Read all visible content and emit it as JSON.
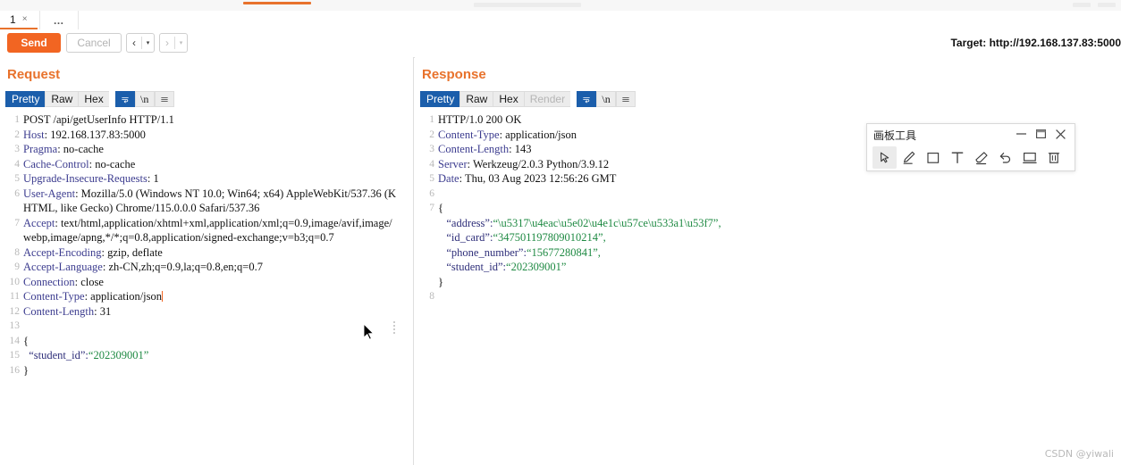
{
  "window": {
    "tabs": [
      {
        "label": "1",
        "close": "×"
      },
      {
        "label": "…"
      }
    ],
    "target_label": "Target: http://192.168.137.83:5000"
  },
  "actionbar": {
    "send_label": "Send",
    "cancel_label": "Cancel",
    "back_chevron": "‹",
    "forward_chevron": "›",
    "caret": "▾"
  },
  "request": {
    "title": "Request",
    "tabs": [
      {
        "label": "Pretty",
        "state": "on"
      },
      {
        "label": "Raw",
        "state": "off"
      },
      {
        "label": "Hex",
        "state": "off"
      }
    ],
    "icon_buttons": [
      {
        "name": "word-wrap-icon",
        "state": "on"
      },
      {
        "name": "newline-icon",
        "label": "\\n",
        "state": "off"
      },
      {
        "name": "hamburger-menu-icon",
        "state": "off"
      }
    ],
    "lines": [
      {
        "n": "1",
        "segments": [
          {
            "t": "POST /api/getUserInfo HTTP/1.1",
            "c": "plain"
          }
        ]
      },
      {
        "n": "2",
        "segments": [
          {
            "t": "Host",
            "c": "hdrname"
          },
          {
            "t": ": 192.168.137.83:5000",
            "c": "plain"
          }
        ]
      },
      {
        "n": "3",
        "segments": [
          {
            "t": "Pragma",
            "c": "hdrname"
          },
          {
            "t": ": no-cache",
            "c": "plain"
          }
        ]
      },
      {
        "n": "4",
        "segments": [
          {
            "t": "Cache-Control",
            "c": "hdrname"
          },
          {
            "t": ": no-cache",
            "c": "plain"
          }
        ]
      },
      {
        "n": "5",
        "segments": [
          {
            "t": "Upgrade-Insecure-Requests",
            "c": "hdrname"
          },
          {
            "t": ": 1",
            "c": "plain"
          }
        ]
      },
      {
        "n": "6",
        "segments": [
          {
            "t": "User-Agent",
            "c": "hdrname"
          },
          {
            "t": ": Mozilla/5.0 (Windows NT 10.0; Win64; x64) AppleWebKit/537.36 (KHTML, like Gecko) Chrome/115.0.0.0 Safari/537.36",
            "c": "plain"
          }
        ]
      },
      {
        "n": "7",
        "segments": [
          {
            "t": "Accept",
            "c": "hdrname"
          },
          {
            "t": ": text/html,application/xhtml+xml,application/xml;q=0.9,image/avif,image/webp,image/apng,*/*;q=0.8,application/signed-exchange;v=b3;q=0.7",
            "c": "plain"
          }
        ]
      },
      {
        "n": "8",
        "segments": [
          {
            "t": "Accept-Encoding",
            "c": "hdrname"
          },
          {
            "t": ": gzip, deflate",
            "c": "plain"
          }
        ]
      },
      {
        "n": "9",
        "segments": [
          {
            "t": "Accept-Language",
            "c": "hdrname"
          },
          {
            "t": ": zh-CN,zh;q=0.9,la;q=0.8,en;q=0.7",
            "c": "plain"
          }
        ]
      },
      {
        "n": "10",
        "segments": [
          {
            "t": "Connection",
            "c": "hdrname"
          },
          {
            "t": ": close",
            "c": "plain"
          }
        ]
      },
      {
        "n": "11",
        "segments": [
          {
            "t": "Content-Type",
            "c": "hdrname"
          },
          {
            "t": ": application/json",
            "c": "plain"
          },
          {
            "t": "",
            "c": "caret"
          }
        ]
      },
      {
        "n": "12",
        "segments": [
          {
            "t": "Content-Length",
            "c": "hdrname"
          },
          {
            "t": ": 31",
            "c": "plain"
          }
        ]
      },
      {
        "n": "13",
        "segments": [
          {
            "t": "",
            "c": "plain"
          }
        ]
      },
      {
        "n": "14",
        "segments": [
          {
            "t": "{",
            "c": "plain"
          }
        ]
      },
      {
        "n": "15",
        "segments": [
          {
            "t": "  “student_id”:",
            "c": "jkey"
          },
          {
            "t": "“202309001”",
            "c": "jstr"
          }
        ]
      },
      {
        "n": "16",
        "segments": [
          {
            "t": "}",
            "c": "plain"
          }
        ]
      }
    ]
  },
  "response": {
    "title": "Response",
    "tabs": [
      {
        "label": "Pretty",
        "state": "on"
      },
      {
        "label": "Raw",
        "state": "off"
      },
      {
        "label": "Hex",
        "state": "off"
      },
      {
        "label": "Render",
        "state": "dim"
      }
    ],
    "icon_buttons": [
      {
        "name": "word-wrap-icon",
        "state": "on"
      },
      {
        "name": "newline-icon",
        "label": "\\n",
        "state": "off"
      },
      {
        "name": "hamburger-menu-icon",
        "state": "off"
      }
    ],
    "lines": [
      {
        "n": "1",
        "segments": [
          {
            "t": "HTTP/1.0 200 OK",
            "c": "plain"
          }
        ]
      },
      {
        "n": "2",
        "segments": [
          {
            "t": "Content-Type",
            "c": "hdrname"
          },
          {
            "t": ": application/json",
            "c": "plain"
          }
        ]
      },
      {
        "n": "3",
        "segments": [
          {
            "t": "Content-Length",
            "c": "hdrname"
          },
          {
            "t": ": 143",
            "c": "plain"
          }
        ]
      },
      {
        "n": "4",
        "segments": [
          {
            "t": "Server",
            "c": "hdrname"
          },
          {
            "t": ": Werkzeug/2.0.3 Python/3.9.12",
            "c": "plain"
          }
        ]
      },
      {
        "n": "5",
        "segments": [
          {
            "t": "Date",
            "c": "hdrname"
          },
          {
            "t": ": Thu, 03 Aug 2023 12:56:26 GMT",
            "c": "plain"
          }
        ]
      },
      {
        "n": "6",
        "segments": [
          {
            "t": "",
            "c": "plain"
          }
        ]
      },
      {
        "n": "7",
        "segments": [
          {
            "t": "{",
            "c": "plain"
          }
        ]
      },
      {
        "n": "",
        "segments": [
          {
            "t": "   “address”:",
            "c": "jkey"
          },
          {
            "t": "“\\u5317\\u4eac\\u5e02\\u4e1c\\u57ce\\u533a1\\u53f7”,",
            "c": "jstr"
          }
        ]
      },
      {
        "n": "",
        "segments": [
          {
            "t": "   “id_card”:",
            "c": "jkey"
          },
          {
            "t": "“347501197809010214”,",
            "c": "jstr"
          }
        ]
      },
      {
        "n": "",
        "segments": [
          {
            "t": "   “phone_number”:",
            "c": "jkey"
          },
          {
            "t": "“15677280841”,",
            "c": "jstr"
          }
        ]
      },
      {
        "n": "",
        "segments": [
          {
            "t": "   “student_id”:",
            "c": "jkey"
          },
          {
            "t": "“202309001”",
            "c": "jstr"
          }
        ]
      },
      {
        "n": "",
        "segments": [
          {
            "t": "}",
            "c": "plain"
          }
        ]
      },
      {
        "n": "8",
        "segments": [
          {
            "t": "",
            "c": "plain"
          }
        ]
      }
    ]
  },
  "paint_toolbar": {
    "title": "画板工具",
    "minimize": "—",
    "maximize": "❐",
    "close": "✕",
    "tools": [
      {
        "name": "cursor-select-icon",
        "selected": true
      },
      {
        "name": "pen-icon",
        "selected": false
      },
      {
        "name": "rectangle-icon",
        "selected": false
      },
      {
        "name": "text-tool-icon",
        "selected": false
      },
      {
        "name": "eraser-icon",
        "selected": false
      },
      {
        "name": "undo-icon",
        "selected": false
      },
      {
        "name": "screen-icon",
        "selected": false
      },
      {
        "name": "trash-icon",
        "selected": false
      }
    ]
  },
  "watermark": "CSDN @yiwali"
}
